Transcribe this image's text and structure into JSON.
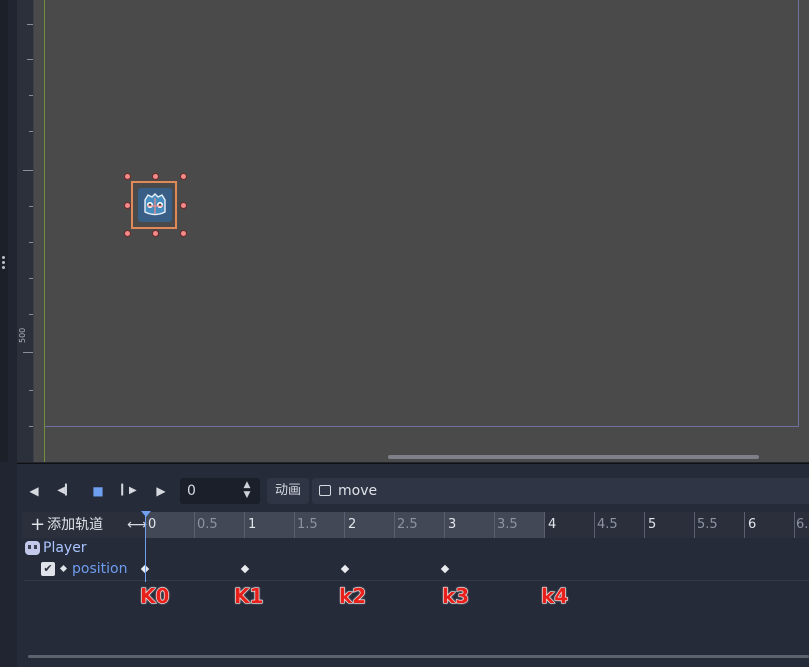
{
  "ruler": {
    "label": "500"
  },
  "toolbar": {
    "play_backwards": "◀",
    "prev_frame": "◀▎",
    "stop": "■",
    "next_frame": "▶",
    "play": "▶",
    "time_value": "0",
    "animation_menu_label": "动画",
    "animation_name": "move"
  },
  "timeline": {
    "add_track_label": "添加轨道",
    "major_labels": [
      "0",
      "1",
      "2",
      "3",
      "4",
      "5",
      "6"
    ],
    "minor_labels": [
      "0.5",
      "1.5",
      "2.5",
      "3.5",
      "4.5",
      "5.5",
      "6."
    ],
    "length": 4,
    "playhead": 0
  },
  "tracks": {
    "node_name": "Player",
    "property_name": "position",
    "enabled": true,
    "keyframes": [
      0,
      1,
      2,
      3
    ]
  },
  "annotations": [
    "K0",
    "K1",
    "k2",
    "k3",
    "k4"
  ],
  "colors": {
    "viewport_bg": "#4a4a4a",
    "panel_bg": "#252b38",
    "accent": "#6fa0f0",
    "selection": "#e08a5a",
    "annotation": "#e8201c"
  }
}
